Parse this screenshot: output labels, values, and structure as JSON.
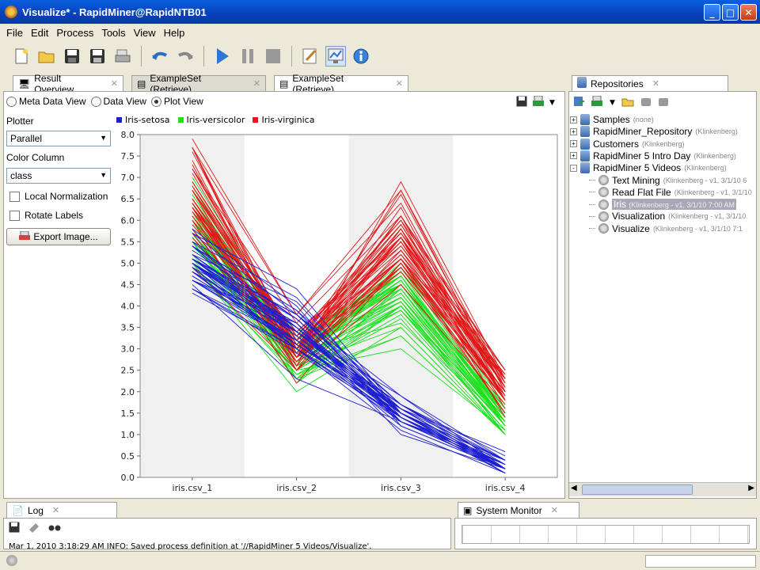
{
  "window": {
    "title": "Visualize* - RapidMiner@RapidNTB01"
  },
  "menu": [
    "File",
    "Edit",
    "Process",
    "Tools",
    "View",
    "Help"
  ],
  "tabs": {
    "main": [
      {
        "label": "Result Overview"
      },
      {
        "label": "ExampleSet (Retrieve)"
      },
      {
        "label": "ExampleSet (Retrieve)"
      }
    ],
    "repositories": "Repositories",
    "log": "Log",
    "system_monitor": "System Monitor"
  },
  "view_modes": {
    "meta": "Meta Data View",
    "data": "Data View",
    "plot": "Plot View",
    "selected": "Plot View"
  },
  "plotter": {
    "label": "Plotter",
    "value": "Parallel",
    "color_label": "Color Column",
    "color_value": "class",
    "local_normalization": "Local Normalization",
    "rotate_labels": "Rotate Labels",
    "export": "Export Image..."
  },
  "colors": {
    "setosa": "#1f1fd0",
    "versicolor": "#1ee01e",
    "virginica": "#e01818"
  },
  "chart_data": {
    "type": "line",
    "subtype": "parallel_coordinates",
    "categories": [
      "iris.csv_1",
      "iris.csv_2",
      "iris.csv_3",
      "iris.csv_4"
    ],
    "ylim": [
      0.0,
      8.0
    ],
    "yticks": [
      "0.0",
      "0.5",
      "1.0",
      "1.5",
      "2.0",
      "2.5",
      "3.0",
      "3.5",
      "4.0",
      "4.5",
      "5.0",
      "5.5",
      "6.0",
      "6.5",
      "7.0",
      "7.5",
      "8.0"
    ],
    "legend": [
      "Iris-setosa",
      "Iris-versicolor",
      "Iris-virginica"
    ],
    "series": [
      {
        "name": "Iris-setosa",
        "values": [
          [
            5.1,
            3.5,
            1.4,
            0.2
          ],
          [
            4.9,
            3.0,
            1.4,
            0.2
          ],
          [
            4.7,
            3.2,
            1.3,
            0.2
          ],
          [
            4.6,
            3.1,
            1.5,
            0.2
          ],
          [
            5.0,
            3.6,
            1.4,
            0.2
          ],
          [
            5.4,
            3.9,
            1.7,
            0.4
          ],
          [
            4.6,
            3.4,
            1.4,
            0.3
          ],
          [
            5.0,
            3.4,
            1.5,
            0.2
          ],
          [
            4.4,
            2.9,
            1.4,
            0.2
          ],
          [
            4.9,
            3.1,
            1.5,
            0.1
          ],
          [
            5.4,
            3.7,
            1.5,
            0.2
          ],
          [
            4.8,
            3.4,
            1.6,
            0.2
          ],
          [
            4.8,
            3.0,
            1.4,
            0.1
          ],
          [
            4.3,
            3.0,
            1.1,
            0.1
          ],
          [
            5.8,
            4.0,
            1.2,
            0.2
          ],
          [
            5.7,
            4.4,
            1.5,
            0.4
          ],
          [
            5.4,
            3.9,
            1.3,
            0.4
          ],
          [
            5.1,
            3.5,
            1.4,
            0.3
          ],
          [
            5.7,
            3.8,
            1.7,
            0.3
          ],
          [
            5.1,
            3.8,
            1.5,
            0.3
          ],
          [
            5.4,
            3.4,
            1.7,
            0.2
          ],
          [
            5.1,
            3.7,
            1.5,
            0.4
          ],
          [
            4.6,
            3.6,
            1.0,
            0.2
          ],
          [
            5.1,
            3.3,
            1.7,
            0.5
          ],
          [
            4.8,
            3.4,
            1.9,
            0.2
          ],
          [
            5.0,
            3.0,
            1.6,
            0.2
          ],
          [
            5.0,
            3.4,
            1.6,
            0.4
          ],
          [
            5.2,
            3.5,
            1.5,
            0.2
          ],
          [
            5.2,
            3.4,
            1.4,
            0.2
          ],
          [
            4.7,
            3.2,
            1.6,
            0.2
          ],
          [
            4.8,
            3.1,
            1.6,
            0.2
          ],
          [
            5.4,
            3.4,
            1.5,
            0.4
          ],
          [
            5.2,
            4.1,
            1.5,
            0.1
          ],
          [
            5.5,
            4.2,
            1.4,
            0.2
          ],
          [
            4.9,
            3.1,
            1.5,
            0.2
          ],
          [
            5.0,
            3.2,
            1.2,
            0.2
          ],
          [
            5.5,
            3.5,
            1.3,
            0.2
          ],
          [
            4.9,
            3.6,
            1.4,
            0.1
          ],
          [
            4.4,
            3.0,
            1.3,
            0.2
          ],
          [
            5.1,
            3.4,
            1.5,
            0.2
          ],
          [
            5.0,
            3.5,
            1.3,
            0.3
          ],
          [
            4.5,
            2.3,
            1.3,
            0.3
          ],
          [
            4.4,
            3.2,
            1.3,
            0.2
          ],
          [
            5.0,
            3.5,
            1.6,
            0.6
          ],
          [
            5.1,
            3.8,
            1.9,
            0.4
          ],
          [
            4.8,
            3.0,
            1.4,
            0.3
          ],
          [
            5.1,
            3.8,
            1.6,
            0.2
          ],
          [
            4.6,
            3.2,
            1.4,
            0.2
          ],
          [
            5.3,
            3.7,
            1.5,
            0.2
          ],
          [
            5.0,
            3.3,
            1.4,
            0.2
          ]
        ]
      },
      {
        "name": "Iris-versicolor",
        "values": [
          [
            7.0,
            3.2,
            4.7,
            1.4
          ],
          [
            6.4,
            3.2,
            4.5,
            1.5
          ],
          [
            6.9,
            3.1,
            4.9,
            1.5
          ],
          [
            5.5,
            2.3,
            4.0,
            1.3
          ],
          [
            6.5,
            2.8,
            4.6,
            1.5
          ],
          [
            5.7,
            2.8,
            4.5,
            1.3
          ],
          [
            6.3,
            3.3,
            4.7,
            1.6
          ],
          [
            4.9,
            2.4,
            3.3,
            1.0
          ],
          [
            6.6,
            2.9,
            4.6,
            1.3
          ],
          [
            5.2,
            2.7,
            3.9,
            1.4
          ],
          [
            5.0,
            2.0,
            3.5,
            1.0
          ],
          [
            5.9,
            3.0,
            4.2,
            1.5
          ],
          [
            6.0,
            2.2,
            4.0,
            1.0
          ],
          [
            6.1,
            2.9,
            4.7,
            1.4
          ],
          [
            5.6,
            2.9,
            3.6,
            1.3
          ],
          [
            6.7,
            3.1,
            4.4,
            1.4
          ],
          [
            5.6,
            3.0,
            4.5,
            1.5
          ],
          [
            5.8,
            2.7,
            4.1,
            1.0
          ],
          [
            6.2,
            2.2,
            4.5,
            1.5
          ],
          [
            5.6,
            2.5,
            3.9,
            1.1
          ],
          [
            5.9,
            3.2,
            4.8,
            1.8
          ],
          [
            6.1,
            2.8,
            4.0,
            1.3
          ],
          [
            6.3,
            2.5,
            4.9,
            1.5
          ],
          [
            6.1,
            2.8,
            4.7,
            1.2
          ],
          [
            6.4,
            2.9,
            4.3,
            1.3
          ],
          [
            6.6,
            3.0,
            4.4,
            1.4
          ],
          [
            6.8,
            2.8,
            4.8,
            1.4
          ],
          [
            6.7,
            3.0,
            5.0,
            1.7
          ],
          [
            6.0,
            2.9,
            4.5,
            1.5
          ],
          [
            5.7,
            2.6,
            3.5,
            1.0
          ],
          [
            5.5,
            2.4,
            3.8,
            1.1
          ],
          [
            5.5,
            2.4,
            3.7,
            1.0
          ],
          [
            5.8,
            2.7,
            3.9,
            1.2
          ],
          [
            6.0,
            2.7,
            5.1,
            1.6
          ],
          [
            5.4,
            3.0,
            4.5,
            1.5
          ],
          [
            6.0,
            3.4,
            4.5,
            1.6
          ],
          [
            6.7,
            3.1,
            4.7,
            1.5
          ],
          [
            6.3,
            2.3,
            4.4,
            1.3
          ],
          [
            5.6,
            3.0,
            4.1,
            1.3
          ],
          [
            5.5,
            2.5,
            4.0,
            1.3
          ],
          [
            5.5,
            2.6,
            4.4,
            1.2
          ],
          [
            6.1,
            3.0,
            4.6,
            1.4
          ],
          [
            5.8,
            2.6,
            4.0,
            1.2
          ],
          [
            5.0,
            2.3,
            3.3,
            1.0
          ],
          [
            5.6,
            2.7,
            4.2,
            1.3
          ],
          [
            5.7,
            3.0,
            4.2,
            1.2
          ],
          [
            5.7,
            2.9,
            4.2,
            1.3
          ],
          [
            6.2,
            2.9,
            4.3,
            1.3
          ],
          [
            5.1,
            2.5,
            3.0,
            1.1
          ],
          [
            5.7,
            2.8,
            4.1,
            1.3
          ]
        ]
      },
      {
        "name": "Iris-virginica",
        "values": [
          [
            6.3,
            3.3,
            6.0,
            2.5
          ],
          [
            5.8,
            2.7,
            5.1,
            1.9
          ],
          [
            7.1,
            3.0,
            5.9,
            2.1
          ],
          [
            6.3,
            2.9,
            5.6,
            1.8
          ],
          [
            6.5,
            3.0,
            5.8,
            2.2
          ],
          [
            7.6,
            3.0,
            6.6,
            2.1
          ],
          [
            4.9,
            2.5,
            4.5,
            1.7
          ],
          [
            7.3,
            2.9,
            6.3,
            1.8
          ],
          [
            6.7,
            2.5,
            5.8,
            1.8
          ],
          [
            7.2,
            3.6,
            6.1,
            2.5
          ],
          [
            6.5,
            3.2,
            5.1,
            2.0
          ],
          [
            6.4,
            2.7,
            5.3,
            1.9
          ],
          [
            6.8,
            3.0,
            5.5,
            2.1
          ],
          [
            5.7,
            2.5,
            5.0,
            2.0
          ],
          [
            5.8,
            2.8,
            5.1,
            2.4
          ],
          [
            6.4,
            3.2,
            5.3,
            2.3
          ],
          [
            6.5,
            3.0,
            5.5,
            1.8
          ],
          [
            7.7,
            3.8,
            6.7,
            2.2
          ],
          [
            7.7,
            2.6,
            6.9,
            2.3
          ],
          [
            6.0,
            2.2,
            5.0,
            1.5
          ],
          [
            6.9,
            3.2,
            5.7,
            2.3
          ],
          [
            5.6,
            2.8,
            4.9,
            2.0
          ],
          [
            7.7,
            2.8,
            6.7,
            2.0
          ],
          [
            6.3,
            2.7,
            4.9,
            1.8
          ],
          [
            6.7,
            3.3,
            5.7,
            2.1
          ],
          [
            7.2,
            3.2,
            6.0,
            1.8
          ],
          [
            6.2,
            2.8,
            4.8,
            1.8
          ],
          [
            6.1,
            3.0,
            4.9,
            1.8
          ],
          [
            6.4,
            2.8,
            5.6,
            2.1
          ],
          [
            7.2,
            3.0,
            5.8,
            1.6
          ],
          [
            7.4,
            2.8,
            6.1,
            1.9
          ],
          [
            7.9,
            3.8,
            6.4,
            2.0
          ],
          [
            6.4,
            2.8,
            5.6,
            2.2
          ],
          [
            6.3,
            2.8,
            5.1,
            1.5
          ],
          [
            6.1,
            2.6,
            5.6,
            1.4
          ],
          [
            7.7,
            3.0,
            6.1,
            2.3
          ],
          [
            6.3,
            3.4,
            5.6,
            2.4
          ],
          [
            6.4,
            3.1,
            5.5,
            1.8
          ],
          [
            6.0,
            3.0,
            4.8,
            1.8
          ],
          [
            6.9,
            3.1,
            5.4,
            2.1
          ],
          [
            6.7,
            3.1,
            5.6,
            2.4
          ],
          [
            6.9,
            3.1,
            5.1,
            2.3
          ],
          [
            5.8,
            2.7,
            5.1,
            1.9
          ],
          [
            6.8,
            3.2,
            5.9,
            2.3
          ],
          [
            6.7,
            3.3,
            5.7,
            2.5
          ],
          [
            6.7,
            3.0,
            5.2,
            2.3
          ],
          [
            6.3,
            2.5,
            5.0,
            1.9
          ],
          [
            6.5,
            3.0,
            5.2,
            2.0
          ],
          [
            6.2,
            3.4,
            5.4,
            2.3
          ],
          [
            5.9,
            3.0,
            5.1,
            1.8
          ]
        ]
      }
    ]
  },
  "repositories": {
    "items": [
      {
        "label": "Samples",
        "meta": "(none)",
        "level": 0,
        "exp": "+"
      },
      {
        "label": "RapidMiner_Repository",
        "meta": "(Klinkenberg)",
        "level": 0,
        "exp": "+"
      },
      {
        "label": "Customers",
        "meta": "(Klinkenberg)",
        "level": 0,
        "exp": "+"
      },
      {
        "label": "RapidMiner 5 Intro Day",
        "meta": "(Klinkenberg)",
        "level": 0,
        "exp": "+"
      },
      {
        "label": "RapidMiner 5 Videos",
        "meta": "(Klinkenberg)",
        "level": 0,
        "exp": "-"
      },
      {
        "label": "Text Mining",
        "meta": "(Klinkenberg - v1, 3/1/10 6",
        "level": 1
      },
      {
        "label": "Read Flat File",
        "meta": "(Klinkenberg - v1, 3/1/10",
        "level": 1
      },
      {
        "label": "Iris",
        "meta": "(Klinkenberg - v1, 3/1/10 7:00 AM",
        "level": 1,
        "selected": true
      },
      {
        "label": "Visualization",
        "meta": "(Klinkenberg - v1, 3/1/10",
        "level": 1
      },
      {
        "label": "Visualize",
        "meta": "(Klinkenberg - v1, 3/1/10 7:1",
        "level": 1
      }
    ]
  },
  "log": {
    "text": "Mar 1, 2010 3:18:29 AM INFO: Saved process definition at '//RapidMiner 5 Videos/Visualize'."
  }
}
